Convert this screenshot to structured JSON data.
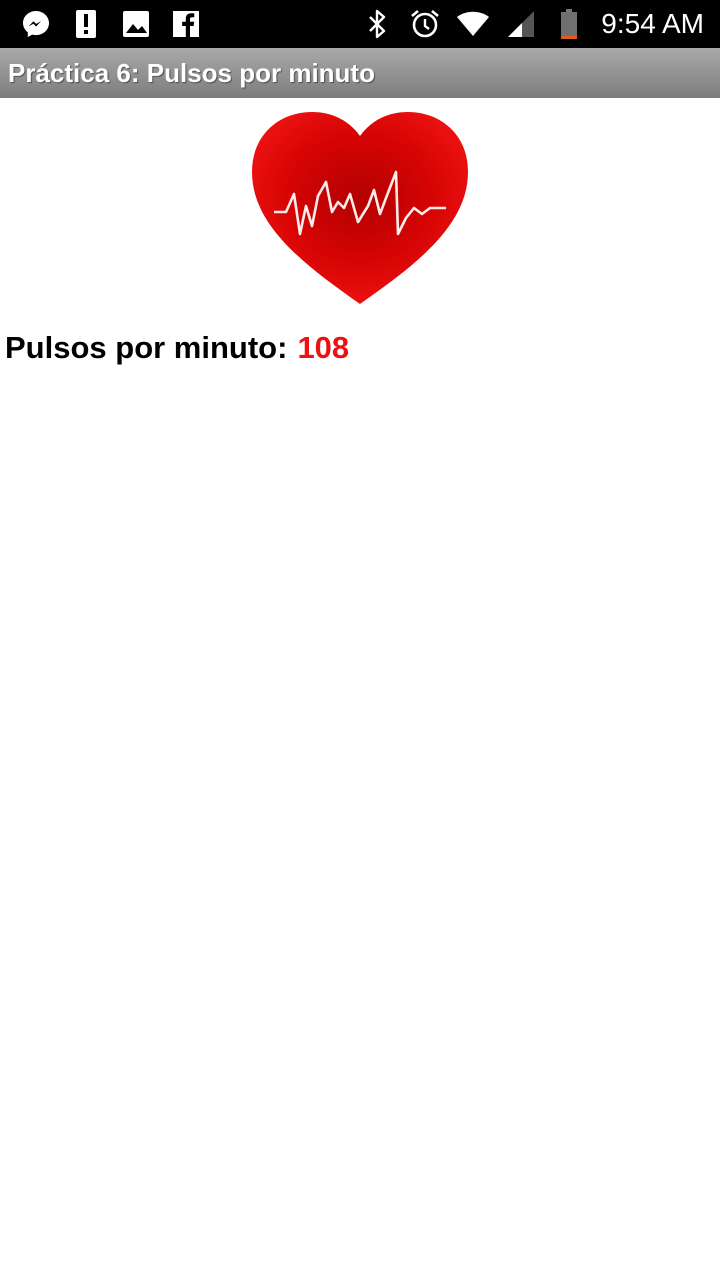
{
  "status_bar": {
    "left_icons": [
      "messenger-icon",
      "alert-icon",
      "image-icon",
      "facebook-icon"
    ],
    "right_icons": [
      "bluetooth-icon",
      "alarm-icon",
      "wifi-icon",
      "signal-icon",
      "battery-icon"
    ],
    "time": "9:54 AM"
  },
  "action_bar": {
    "title": "Práctica 6: Pulsos por minuto"
  },
  "main": {
    "heart_image": "heart-pulse-icon",
    "pulse_label": "Pulsos por minuto:",
    "pulse_value": "108"
  },
  "colors": {
    "pulse_value": "#ee1111",
    "heart_red": "#e20a0a",
    "heart_dark": "#b30000",
    "action_bar_top": "#a9a9a9",
    "action_bar_bottom": "#7d7d7d",
    "status_bar": "#000000"
  }
}
